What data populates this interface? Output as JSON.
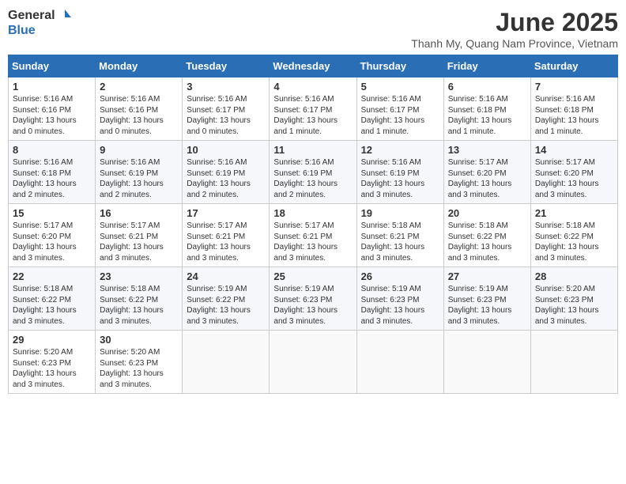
{
  "logo": {
    "general": "General",
    "blue": "Blue"
  },
  "title": "June 2025",
  "subtitle": "Thanh My, Quang Nam Province, Vietnam",
  "weekdays": [
    "Sunday",
    "Monday",
    "Tuesday",
    "Wednesday",
    "Thursday",
    "Friday",
    "Saturday"
  ],
  "weeks": [
    [
      {
        "day": "1",
        "sunrise": "5:16 AM",
        "sunset": "6:16 PM",
        "daylight": "13 hours and 0 minutes."
      },
      {
        "day": "2",
        "sunrise": "5:16 AM",
        "sunset": "6:16 PM",
        "daylight": "13 hours and 0 minutes."
      },
      {
        "day": "3",
        "sunrise": "5:16 AM",
        "sunset": "6:17 PM",
        "daylight": "13 hours and 0 minutes."
      },
      {
        "day": "4",
        "sunrise": "5:16 AM",
        "sunset": "6:17 PM",
        "daylight": "13 hours and 1 minute."
      },
      {
        "day": "5",
        "sunrise": "5:16 AM",
        "sunset": "6:17 PM",
        "daylight": "13 hours and 1 minute."
      },
      {
        "day": "6",
        "sunrise": "5:16 AM",
        "sunset": "6:18 PM",
        "daylight": "13 hours and 1 minute."
      },
      {
        "day": "7",
        "sunrise": "5:16 AM",
        "sunset": "6:18 PM",
        "daylight": "13 hours and 1 minute."
      }
    ],
    [
      {
        "day": "8",
        "sunrise": "5:16 AM",
        "sunset": "6:18 PM",
        "daylight": "13 hours and 2 minutes."
      },
      {
        "day": "9",
        "sunrise": "5:16 AM",
        "sunset": "6:19 PM",
        "daylight": "13 hours and 2 minutes."
      },
      {
        "day": "10",
        "sunrise": "5:16 AM",
        "sunset": "6:19 PM",
        "daylight": "13 hours and 2 minutes."
      },
      {
        "day": "11",
        "sunrise": "5:16 AM",
        "sunset": "6:19 PM",
        "daylight": "13 hours and 2 minutes."
      },
      {
        "day": "12",
        "sunrise": "5:16 AM",
        "sunset": "6:19 PM",
        "daylight": "13 hours and 3 minutes."
      },
      {
        "day": "13",
        "sunrise": "5:17 AM",
        "sunset": "6:20 PM",
        "daylight": "13 hours and 3 minutes."
      },
      {
        "day": "14",
        "sunrise": "5:17 AM",
        "sunset": "6:20 PM",
        "daylight": "13 hours and 3 minutes."
      }
    ],
    [
      {
        "day": "15",
        "sunrise": "5:17 AM",
        "sunset": "6:20 PM",
        "daylight": "13 hours and 3 minutes."
      },
      {
        "day": "16",
        "sunrise": "5:17 AM",
        "sunset": "6:21 PM",
        "daylight": "13 hours and 3 minutes."
      },
      {
        "day": "17",
        "sunrise": "5:17 AM",
        "sunset": "6:21 PM",
        "daylight": "13 hours and 3 minutes."
      },
      {
        "day": "18",
        "sunrise": "5:17 AM",
        "sunset": "6:21 PM",
        "daylight": "13 hours and 3 minutes."
      },
      {
        "day": "19",
        "sunrise": "5:18 AM",
        "sunset": "6:21 PM",
        "daylight": "13 hours and 3 minutes."
      },
      {
        "day": "20",
        "sunrise": "5:18 AM",
        "sunset": "6:22 PM",
        "daylight": "13 hours and 3 minutes."
      },
      {
        "day": "21",
        "sunrise": "5:18 AM",
        "sunset": "6:22 PM",
        "daylight": "13 hours and 3 minutes."
      }
    ],
    [
      {
        "day": "22",
        "sunrise": "5:18 AM",
        "sunset": "6:22 PM",
        "daylight": "13 hours and 3 minutes."
      },
      {
        "day": "23",
        "sunrise": "5:18 AM",
        "sunset": "6:22 PM",
        "daylight": "13 hours and 3 minutes."
      },
      {
        "day": "24",
        "sunrise": "5:19 AM",
        "sunset": "6:22 PM",
        "daylight": "13 hours and 3 minutes."
      },
      {
        "day": "25",
        "sunrise": "5:19 AM",
        "sunset": "6:23 PM",
        "daylight": "13 hours and 3 minutes."
      },
      {
        "day": "26",
        "sunrise": "5:19 AM",
        "sunset": "6:23 PM",
        "daylight": "13 hours and 3 minutes."
      },
      {
        "day": "27",
        "sunrise": "5:19 AM",
        "sunset": "6:23 PM",
        "daylight": "13 hours and 3 minutes."
      },
      {
        "day": "28",
        "sunrise": "5:20 AM",
        "sunset": "6:23 PM",
        "daylight": "13 hours and 3 minutes."
      }
    ],
    [
      {
        "day": "29",
        "sunrise": "5:20 AM",
        "sunset": "6:23 PM",
        "daylight": "13 hours and 3 minutes."
      },
      {
        "day": "30",
        "sunrise": "5:20 AM",
        "sunset": "6:23 PM",
        "daylight": "13 hours and 3 minutes."
      },
      null,
      null,
      null,
      null,
      null
    ]
  ],
  "labels": {
    "sunrise": "Sunrise:",
    "sunset": "Sunset:",
    "daylight": "Daylight:"
  }
}
